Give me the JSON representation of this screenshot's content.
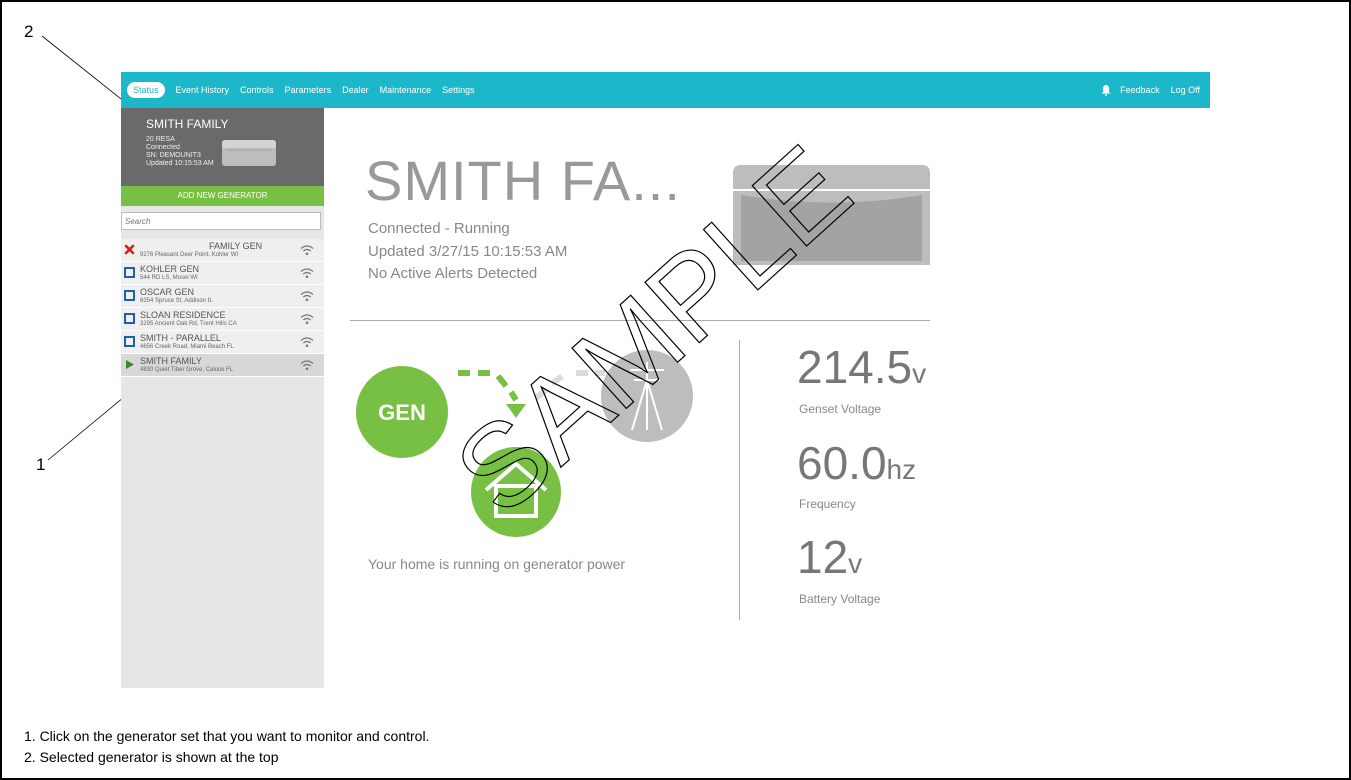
{
  "callouts": {
    "one": "1",
    "two": "2"
  },
  "nav": {
    "items": [
      "Status",
      "Event History",
      "Controls",
      "Parameters",
      "Dealer",
      "Maintenance",
      "Settings"
    ],
    "feedback": "Feedback",
    "logoff": "Log Off"
  },
  "selected": {
    "title": "SMITH FAMILY",
    "model": "20 RESA",
    "conn": "Connected",
    "sn": "SN: DEMOUNIT3",
    "updated": "Updated 10:15:53 AM"
  },
  "add_button": "ADD NEW GENERATOR",
  "search_placeholder": "Search",
  "generators": [
    {
      "name": "FAMILY GEN",
      "addr": "9276 Pleasant Deer Point, Kohler WI",
      "status": "error"
    },
    {
      "name": "KOHLER GEN",
      "addr": "544 RD LS, Mosel WI",
      "status": "stopped"
    },
    {
      "name": "OSCAR GEN",
      "addr": "6354 Spruce St, Addison IL",
      "status": "stopped"
    },
    {
      "name": "SLOAN RESIDENCE",
      "addr": "3295 Ancient Oak Rd, Trent Hills CA",
      "status": "stopped"
    },
    {
      "name": "SMITH - PARALLEL",
      "addr": "4656 Creek Road, Miami Beach FL",
      "status": "stopped"
    },
    {
      "name": "SMITH FAMILY",
      "addr": "4830 Quiet Tiber Grove, Calook FL",
      "status": "running"
    }
  ],
  "main": {
    "title": "SMITH FA...",
    "status": "Connected - Running",
    "updated": "Updated 3/27/15 10:15:53 AM",
    "alerts": "No Active Alerts Detected",
    "gen_label": "GEN",
    "home_msg": "Your home is running on generator power"
  },
  "metrics": [
    {
      "value": "214.5",
      "unit": "v",
      "label": "Genset Voltage"
    },
    {
      "value": "60.0",
      "unit": "hz",
      "label": "Frequency"
    },
    {
      "value": "12",
      "unit": "v",
      "label": "Battery Voltage"
    }
  ],
  "watermark": "SAMPLE",
  "colors": {
    "teal": "#1cb8c9",
    "green": "#78c043",
    "gray": "#6a6a6a",
    "error": "#cc2222",
    "stopped": "#1f5fb0"
  },
  "footnotes": [
    "1. Click on the generator set that you want to monitor and control.",
    "2. Selected generator is shown at the top"
  ]
}
